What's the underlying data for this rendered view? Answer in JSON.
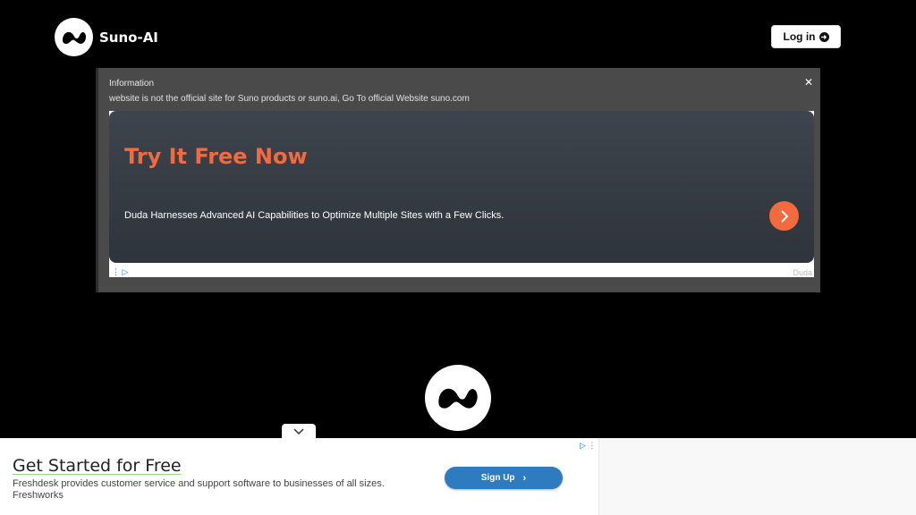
{
  "header": {
    "brand": "Suno-AI",
    "login_label": "Log in",
    "login_icon": "arrow-right-circle-icon"
  },
  "info_banner": {
    "title": "Information",
    "message": "website is not the official site for Suno products or suno.ai, Go To official Website suno.com",
    "close_icon": "close-icon"
  },
  "ad_top": {
    "headline": "Try It Free Now",
    "description": "Duda Harnesses Advanced AI Capabilities to Optimize Multiple Sites with a Few Clicks.",
    "advertiser": "Duda",
    "accent_color": "#f26a3d"
  },
  "ad_bottom": {
    "headline": "Get Started for Free",
    "description": "Freshdesk provides customer service and support software to businesses of all sizes.",
    "advertiser": "Freshworks",
    "cta_label": "Sign Up",
    "cta_color": "#2f7bbf"
  }
}
